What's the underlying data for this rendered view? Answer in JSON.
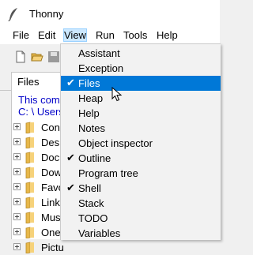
{
  "window": {
    "title": "Thonny"
  },
  "menubar": {
    "items": [
      "File",
      "Edit",
      "View",
      "Run",
      "Tools",
      "Help"
    ]
  },
  "toolbar": {
    "icons": [
      "new-file-icon",
      "open-folder-icon",
      "save-icon"
    ]
  },
  "files_panel": {
    "tab_label": "Files",
    "info_line": "This comp",
    "path_line": "C: \\ Users",
    "items": [
      "Conte",
      "Desk",
      "Docu",
      "Dow",
      "Favo",
      "Links",
      "Mus",
      "Onel",
      "Pictu"
    ]
  },
  "view_menu": {
    "items": [
      {
        "label": "Assistant",
        "checked": false
      },
      {
        "label": "Exception",
        "checked": false
      },
      {
        "label": "Files",
        "checked": true,
        "selected": true
      },
      {
        "label": "Heap",
        "checked": false
      },
      {
        "label": "Help",
        "checked": false
      },
      {
        "label": "Notes",
        "checked": false
      },
      {
        "label": "Object inspector",
        "checked": false
      },
      {
        "label": "Outline",
        "checked": true
      },
      {
        "label": "Program tree",
        "checked": false
      },
      {
        "label": "Shell",
        "checked": true
      },
      {
        "label": "Stack",
        "checked": false
      },
      {
        "label": "TODO",
        "checked": false
      },
      {
        "label": "Variables",
        "checked": false
      }
    ],
    "check_glyph": "✔"
  },
  "colors": {
    "selection": "#0078d7",
    "folder": "#e8b84a",
    "info_text": "#0000c8"
  }
}
